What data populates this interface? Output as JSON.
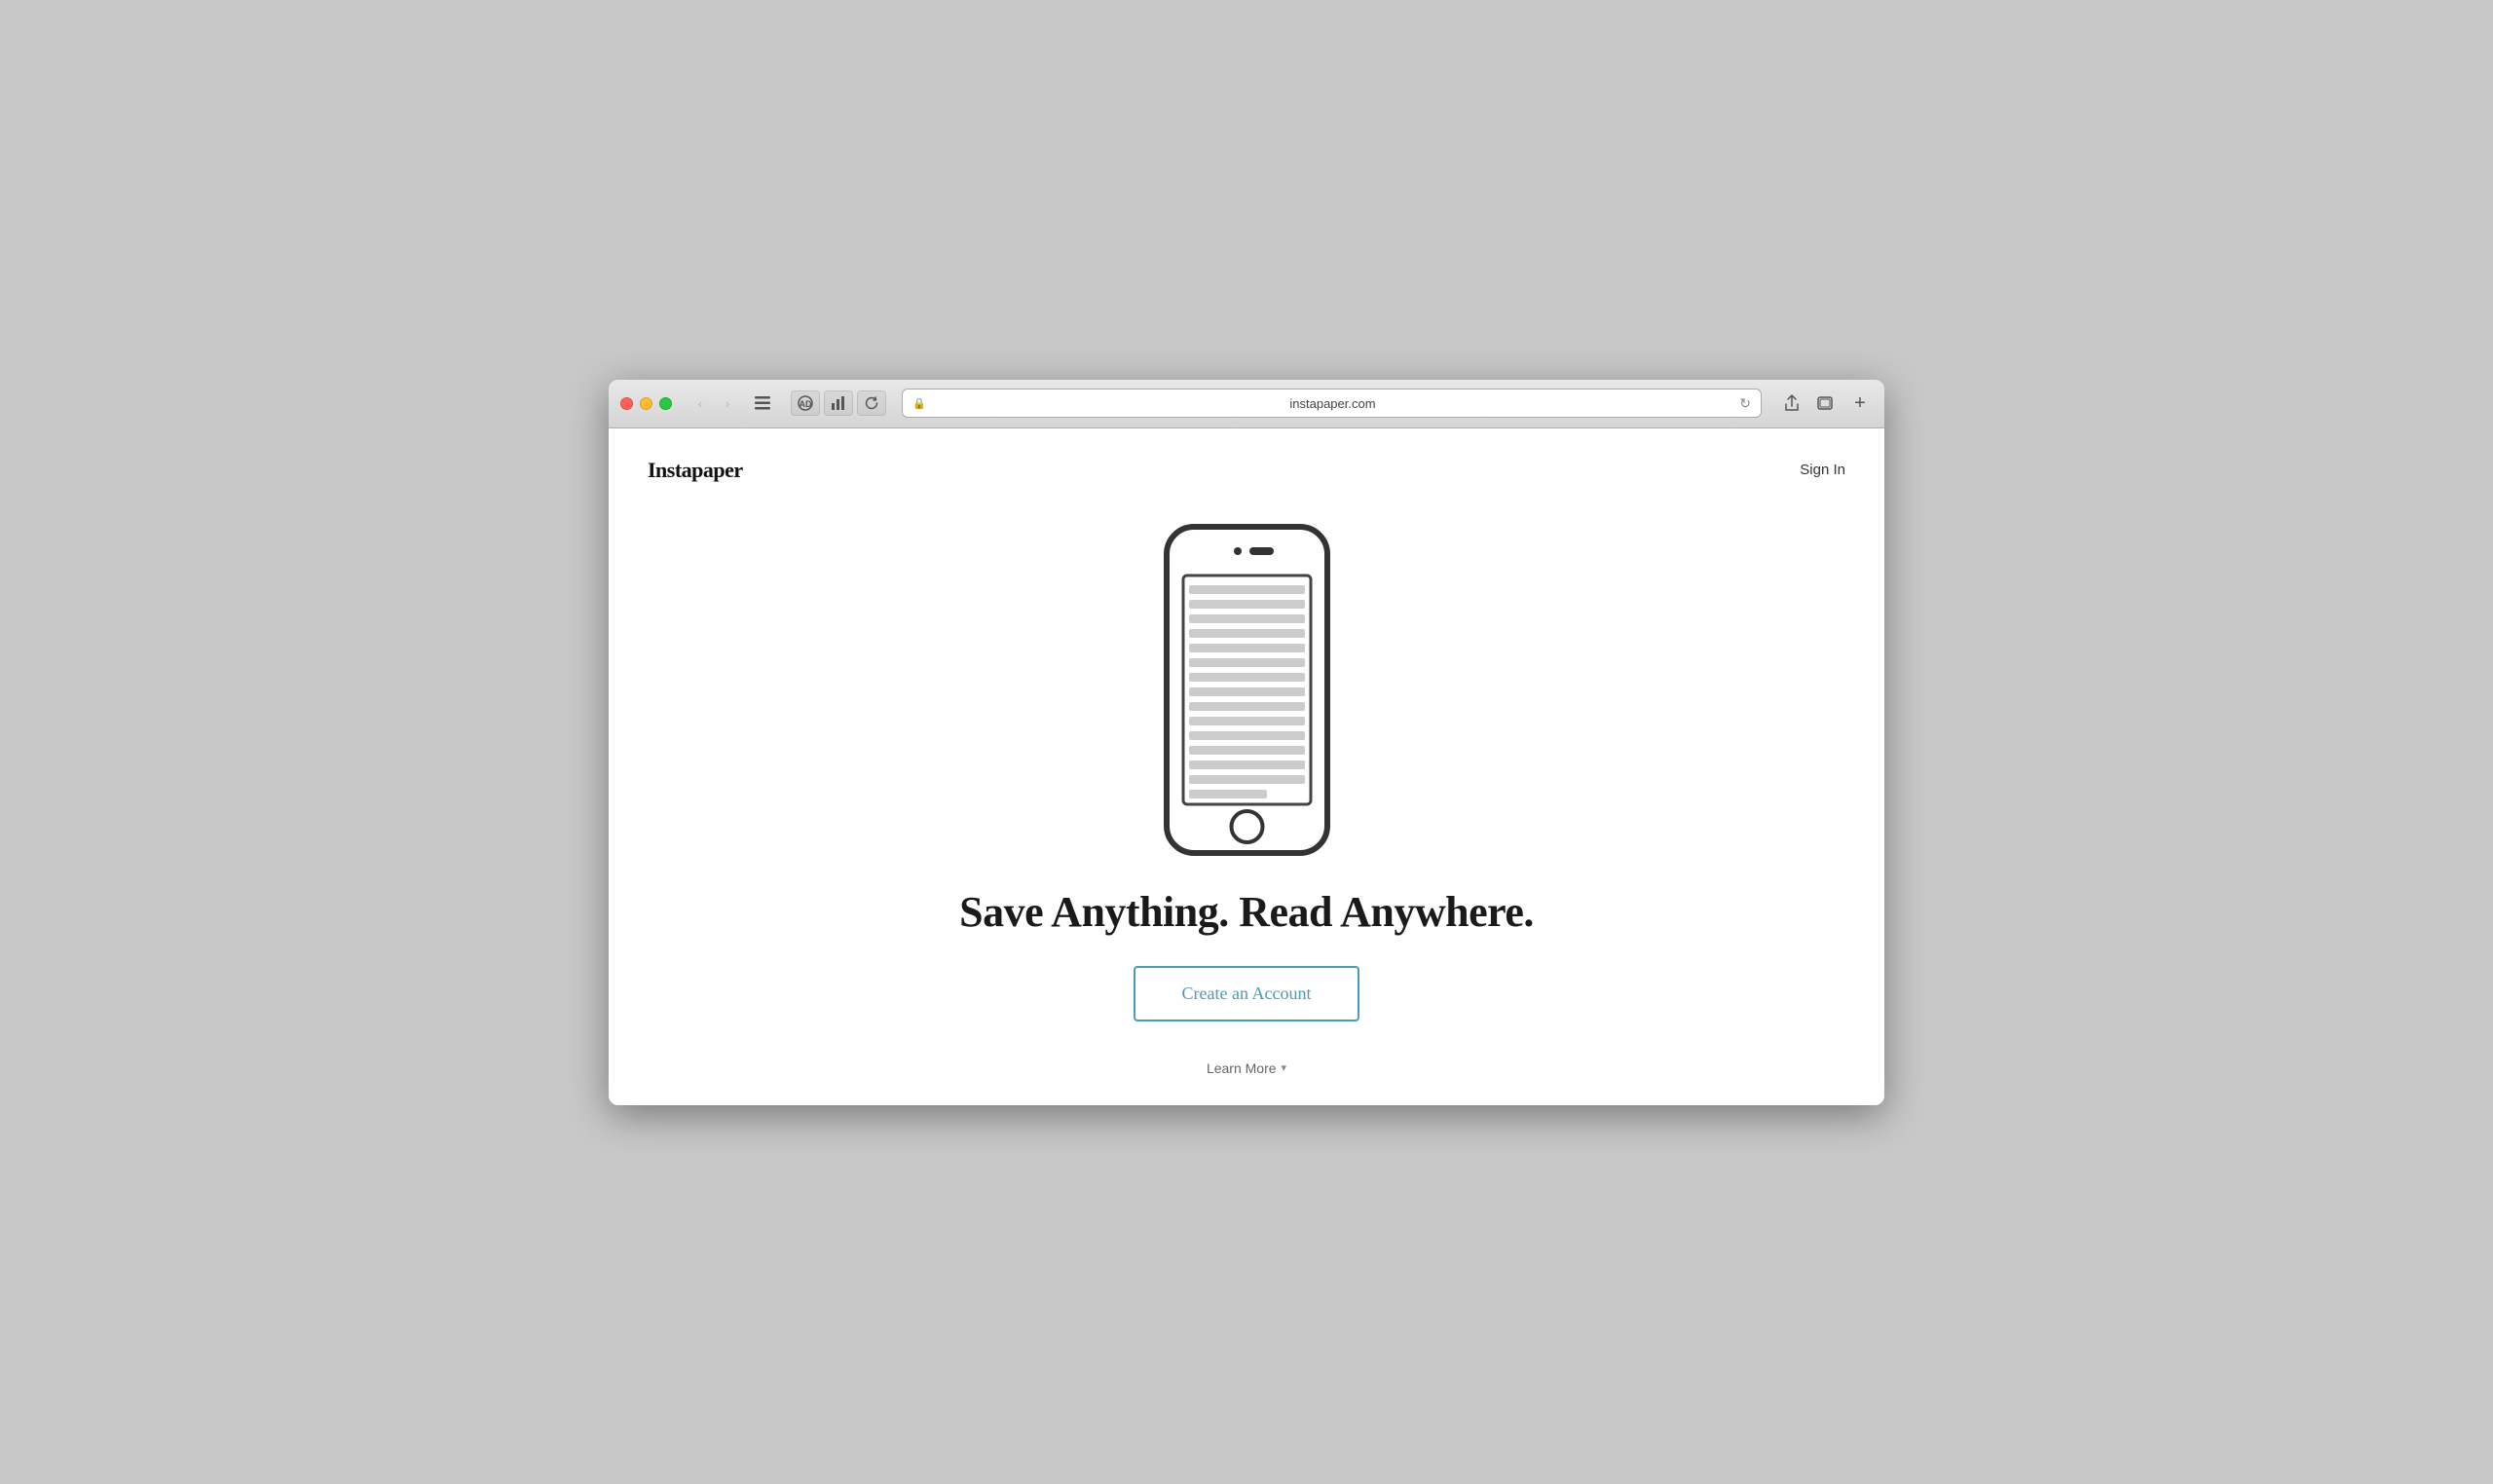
{
  "browser": {
    "url": "instapaper.com",
    "url_display": "instapaper.com",
    "back_disabled": true,
    "forward_disabled": true
  },
  "nav": {
    "logo": "Instapaper",
    "sign_in": "Sign In"
  },
  "hero": {
    "headline": "Save Anything. Read Anywhere.",
    "cta_label": "Create an Account",
    "learn_more_label": "Learn More"
  },
  "phone": {
    "line_color": "#cccccc",
    "border_color": "#333333"
  },
  "colors": {
    "cta_border": "#4a9abe",
    "cta_text": "#4a9abe"
  }
}
